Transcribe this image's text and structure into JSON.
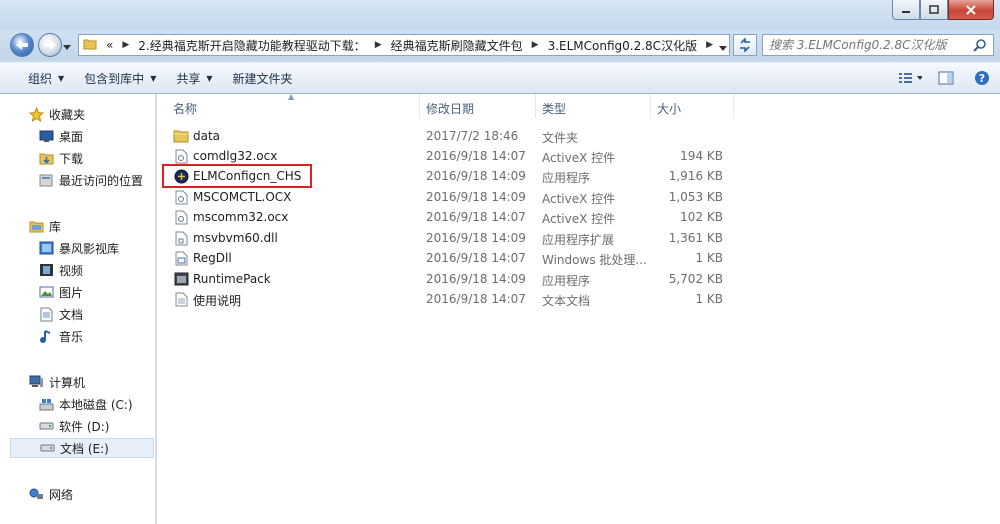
{
  "address": {
    "overflow": "«",
    "crumbs": [
      "2.经典福克斯开启隐藏功能教程驱动下载：",
      "经典福克斯刷隐藏文件包",
      "3.ELMConfig0.2.8C汉化版"
    ],
    "search_placeholder": "搜索 3.ELMConfig0.2.8C汉化版"
  },
  "toolbar": {
    "organize": "组织",
    "include_library": "包含到库中",
    "share": "共享",
    "new_folder": "新建文件夹"
  },
  "sidebar": {
    "favorites": "收藏夹",
    "desktop": "桌面",
    "downloads": "下载",
    "recent": "最近访问的位置",
    "libraries": "库",
    "baofeng": "暴风影视库",
    "videos": "视频",
    "pictures": "图片",
    "documents": "文档",
    "music": "音乐",
    "computer": "计算机",
    "drive_c": "本地磁盘 (C:)",
    "drive_d": "软件 (D:)",
    "drive_e": "文档 (E:)",
    "network": "网络"
  },
  "columns": {
    "name": "名称",
    "date": "修改日期",
    "type": "类型",
    "size": "大小"
  },
  "files": [
    {
      "name": "data",
      "date": "2017/7/2 18:46",
      "type": "文件夹",
      "size": "",
      "icon": "folder-icon"
    },
    {
      "name": "comdlg32.ocx",
      "date": "2016/9/18 14:07",
      "type": "ActiveX 控件",
      "size": "194 KB",
      "icon": "ocx-file-icon"
    },
    {
      "name": "ELMConfigcn_CHS",
      "date": "2016/9/18 14:09",
      "type": "应用程序",
      "size": "1,916 KB",
      "icon": "elmconfig-app-icon"
    },
    {
      "name": "MSCOMCTL.OCX",
      "date": "2016/9/18 14:09",
      "type": "ActiveX 控件",
      "size": "1,053 KB",
      "icon": "ocx-file-icon"
    },
    {
      "name": "mscomm32.ocx",
      "date": "2016/9/18 14:07",
      "type": "ActiveX 控件",
      "size": "102 KB",
      "icon": "ocx-file-icon"
    },
    {
      "name": "msvbvm60.dll",
      "date": "2016/9/18 14:09",
      "type": "应用程序扩展",
      "size": "1,361 KB",
      "icon": "dll-file-icon"
    },
    {
      "name": "RegDll",
      "date": "2016/9/18 14:07",
      "type": "Windows 批处理...",
      "size": "1 KB",
      "icon": "batch-file-icon"
    },
    {
      "name": "RuntimePack",
      "date": "2016/9/18 14:09",
      "type": "应用程序",
      "size": "5,702 KB",
      "icon": "app-icon"
    },
    {
      "name": "使用说明",
      "date": "2016/9/18 14:07",
      "type": "文本文档",
      "size": "1 KB",
      "icon": "text-file-icon"
    }
  ],
  "colors": {
    "highlight_box": "#e02020",
    "selected_row": "#e5eef9"
  }
}
